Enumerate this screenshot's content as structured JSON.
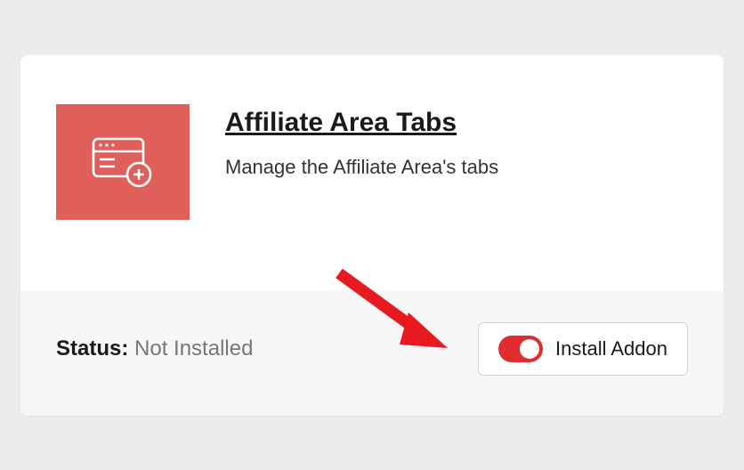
{
  "card": {
    "title": "Affiliate Area Tabs",
    "description": "Manage the Affiliate Area's tabs",
    "icon_color": "#e15f5a"
  },
  "footer": {
    "status_label": "Status: ",
    "status_value": "Not Installed",
    "button_label": "Install Addon"
  }
}
